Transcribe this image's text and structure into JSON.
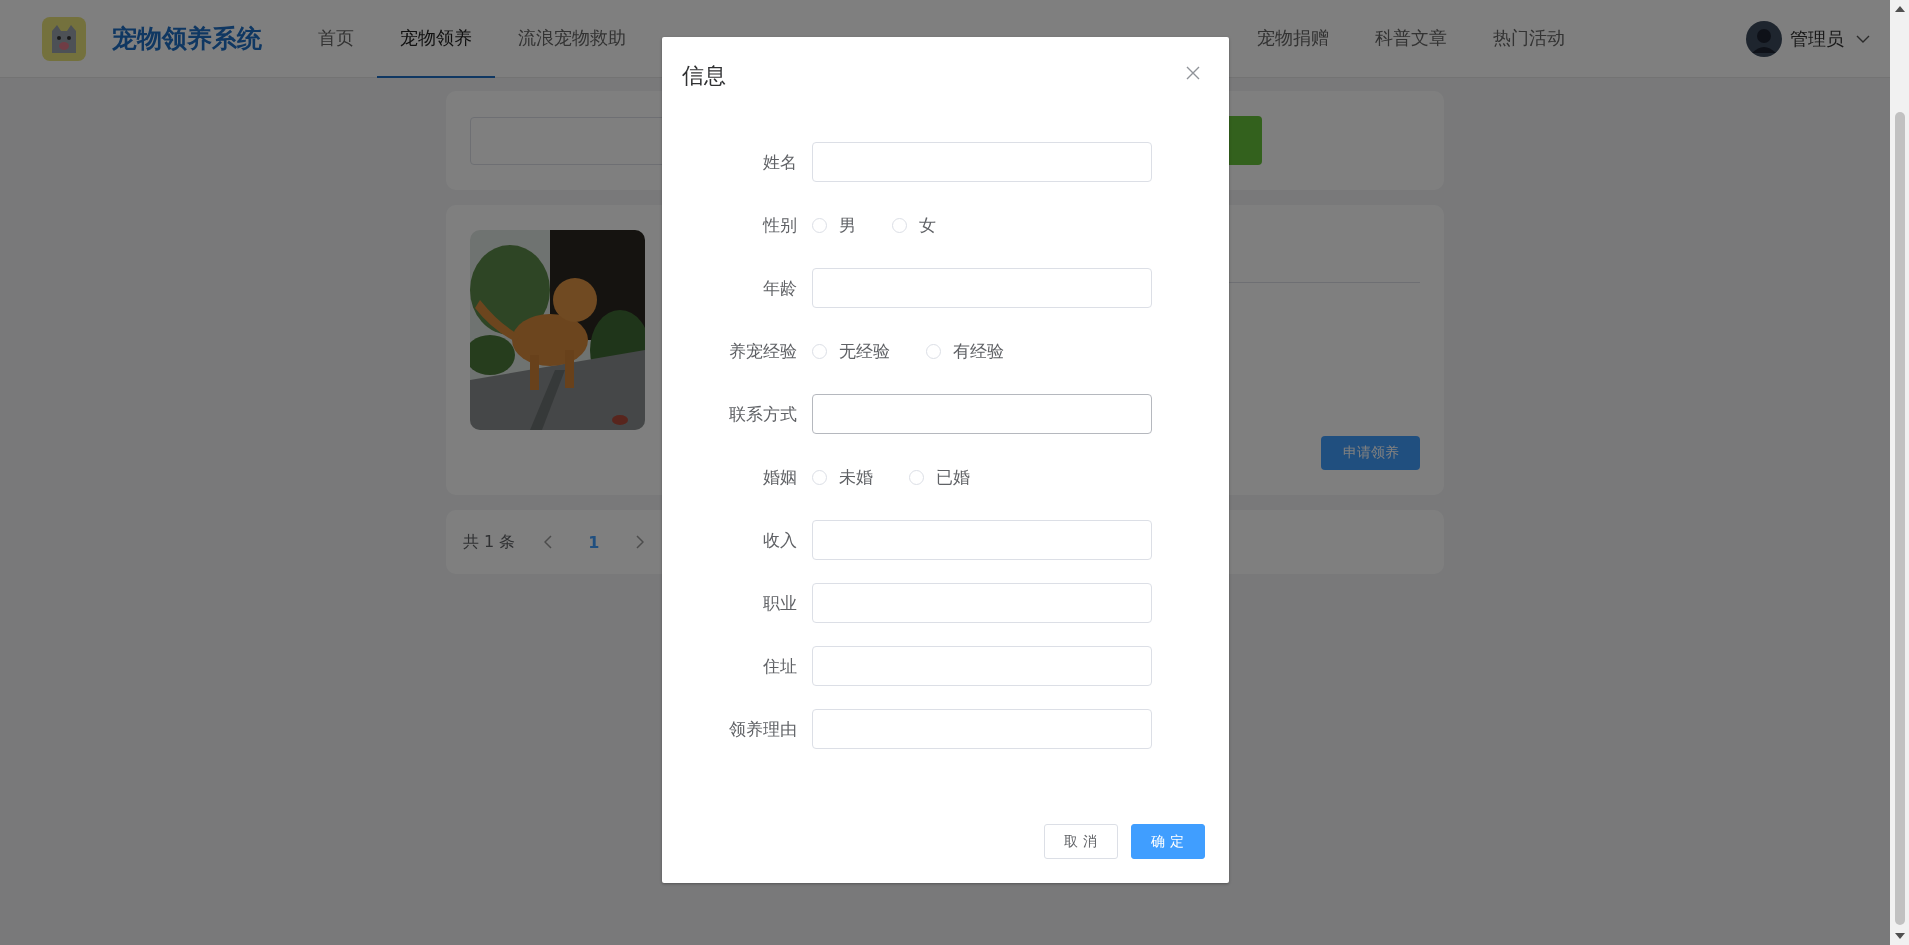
{
  "header": {
    "title": "宠物领养系统",
    "nav": [
      {
        "label": "首页",
        "selected": false
      },
      {
        "label": "宠物领养",
        "selected": true
      },
      {
        "label": "流浪宠物救助",
        "selected": false
      },
      {
        "label": "宠物捐赠",
        "selected": false
      },
      {
        "label": "科普文章",
        "selected": false
      },
      {
        "label": "热门活动",
        "selected": false
      }
    ],
    "user": {
      "name": "管理员"
    }
  },
  "background": {
    "apply_button": "申请领养",
    "pagination": {
      "total": "共 1 条",
      "pages": [
        {
          "label": "1",
          "selected": true
        }
      ]
    }
  },
  "dialog": {
    "title": "信息",
    "fields": [
      {
        "kind": "text",
        "label": "姓名",
        "hovered": false
      },
      {
        "kind": "radio",
        "label": "性别",
        "options": [
          {
            "label": "男",
            "selected": false
          },
          {
            "label": "女",
            "selected": false
          }
        ]
      },
      {
        "kind": "text",
        "label": "年龄",
        "hovered": false
      },
      {
        "kind": "radio",
        "label": "养宠经验",
        "options": [
          {
            "label": "无经验",
            "selected": false
          },
          {
            "label": "有经验",
            "selected": false
          }
        ]
      },
      {
        "kind": "text",
        "label": "联系方式",
        "hovered": true
      },
      {
        "kind": "radio",
        "label": "婚姻",
        "options": [
          {
            "label": "未婚",
            "selected": false
          },
          {
            "label": "已婚",
            "selected": false
          }
        ]
      },
      {
        "kind": "text",
        "label": "收入",
        "hovered": false
      },
      {
        "kind": "text",
        "label": "职业",
        "hovered": false
      },
      {
        "kind": "text",
        "label": "住址",
        "hovered": false
      },
      {
        "kind": "text",
        "label": "领养理由",
        "hovered": false
      }
    ],
    "buttons": [
      {
        "label": "取 消",
        "kind": "default"
      },
      {
        "label": "确 定",
        "kind": "primary"
      }
    ]
  }
}
